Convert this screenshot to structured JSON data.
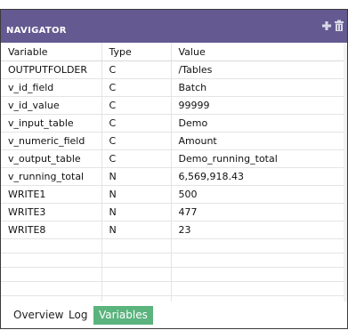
{
  "panel": {
    "title": "NAVIGATOR",
    "actions": [
      {
        "icon": "plus-icon"
      },
      {
        "icon": "trash-icon"
      }
    ]
  },
  "grid": {
    "columns": [
      "Variable",
      "Type",
      "Value"
    ],
    "rows": [
      {
        "variable": "OUTPUTFOLDER",
        "type": "C",
        "value": "/Tables"
      },
      {
        "variable": "v_id_field",
        "type": "C",
        "value": "Batch"
      },
      {
        "variable": "v_id_value",
        "type": "C",
        "value": "99999"
      },
      {
        "variable": "v_input_table",
        "type": "C",
        "value": "Demo"
      },
      {
        "variable": "v_numeric_field",
        "type": "C",
        "value": "Amount"
      },
      {
        "variable": "v_output_table",
        "type": "C",
        "value": "Demo_running_total"
      },
      {
        "variable": "v_running_total",
        "type": "N",
        "value": "6,569,918.43"
      },
      {
        "variable": "WRITE1",
        "type": "N",
        "value": "500"
      },
      {
        "variable": "WRITE3",
        "type": "N",
        "value": "477"
      },
      {
        "variable": "WRITE8",
        "type": "N",
        "value": "23"
      }
    ]
  },
  "tabs": [
    {
      "label": "Overview",
      "active": false
    },
    {
      "label": "Log",
      "active": false
    },
    {
      "label": "Variables",
      "active": true
    }
  ],
  "colors": {
    "titlebar": "#645a91",
    "active_tab": "#5bb37e"
  }
}
